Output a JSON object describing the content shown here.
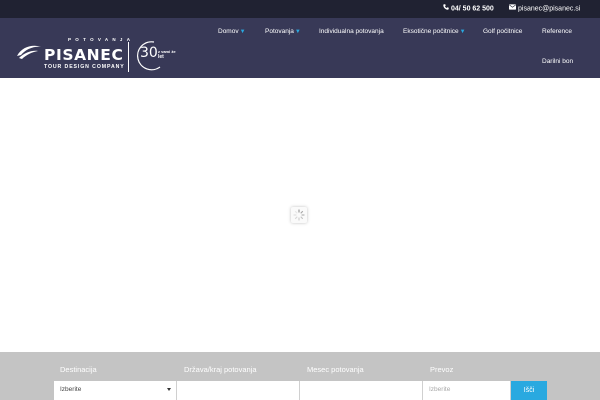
{
  "topbar": {
    "phone": "04/ 50 62 500",
    "email": "pisanec@pisanec.si"
  },
  "logo": {
    "top_word": "POTOVANJA",
    "brand": "PISANEC",
    "subtitle": "TOUR DESIGN COMPANY",
    "anniversary_number": "30",
    "anniversary_unit": "let",
    "anniversary_small": "z vami že"
  },
  "nav": {
    "items": [
      {
        "label": "Domov",
        "has_dropdown": true
      },
      {
        "label": "Potovanja",
        "has_dropdown": true
      },
      {
        "label": "Individualna potovanja",
        "has_dropdown": false
      },
      {
        "label": "Eksotične počitnice",
        "has_dropdown": true
      },
      {
        "label": "Golf počitnice",
        "has_dropdown": false
      },
      {
        "label": "Reference",
        "has_dropdown": false
      },
      {
        "label": "Darilni bon",
        "has_dropdown": false
      }
    ],
    "caret_glyph": "▼"
  },
  "search": {
    "labels": {
      "destination": "Destinacija",
      "country": "Država/kraj potovanja",
      "month": "Mesec potovanja",
      "transport": "Prevoz"
    },
    "destination_value": "Izberite",
    "transport_placeholder": "Izberite",
    "button": "Išči"
  },
  "colors": {
    "topbar": "#202232",
    "header": "#383957",
    "accent": "#29a9e0",
    "searchbar": "#c4c4c4"
  }
}
